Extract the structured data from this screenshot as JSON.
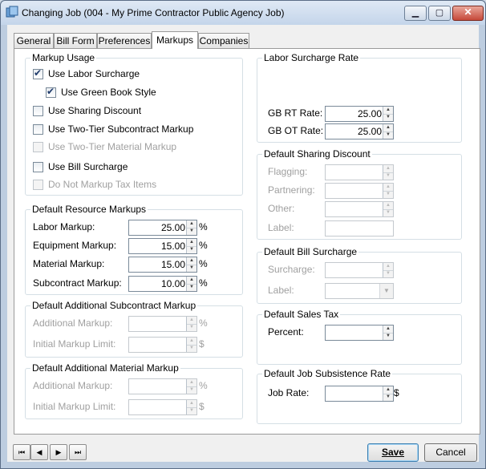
{
  "window": {
    "title": "Changing Job  (004 - My Prime Contractor Public Agency Job)",
    "minimize_glyph": "▁",
    "maximize_glyph": "▢",
    "close_glyph": "✕"
  },
  "tabs": [
    "General",
    "Bill Form",
    "Preferences",
    "Markups",
    "Companies"
  ],
  "active_tab": "Markups",
  "markup_usage": {
    "title": "Markup Usage",
    "use_labor_surcharge": {
      "label": "Use Labor Surcharge",
      "checked": true
    },
    "use_green_book_style": {
      "label": "Use Green Book Style",
      "checked": true
    },
    "use_sharing_discount": {
      "label": "Use Sharing Discount",
      "checked": false
    },
    "use_two_tier_subcontract": {
      "label": "Use Two-Tier Subcontract Markup",
      "checked": false
    },
    "use_two_tier_material": {
      "label": "Use Two-Tier Material Markup",
      "checked": false,
      "disabled": true
    },
    "use_bill_surcharge": {
      "label": "Use Bill Surcharge",
      "checked": false
    },
    "do_not_markup_tax": {
      "label": "Do Not Markup Tax Items",
      "checked": false,
      "disabled": true
    }
  },
  "resource_markups": {
    "title": "Default Resource Markups",
    "labor": {
      "label": "Labor Markup:",
      "value": "25.00",
      "unit": "%"
    },
    "equipment": {
      "label": "Equipment Markup:",
      "value": "15.00",
      "unit": "%"
    },
    "material": {
      "label": "Material Markup:",
      "value": "15.00",
      "unit": "%"
    },
    "subcontract": {
      "label": "Subcontract Markup:",
      "value": "10.00",
      "unit": "%"
    }
  },
  "additional_subcontract": {
    "title": "Default Additional Subcontract Markup",
    "additional": {
      "label": "Additional Markup:",
      "value": "",
      "unit": "%"
    },
    "initial_limit": {
      "label": "Initial Markup Limit:",
      "value": "",
      "unit": "$"
    }
  },
  "additional_material": {
    "title": "Default Additional Material Markup",
    "additional": {
      "label": "Additional Markup:",
      "value": "",
      "unit": "%"
    },
    "initial_limit": {
      "label": "Initial Markup Limit:",
      "value": "",
      "unit": "$"
    }
  },
  "labor_surcharge_rate": {
    "title": "Labor Surcharge Rate",
    "gb_rt": {
      "label": "GB RT Rate:",
      "value": "25.00"
    },
    "gb_ot": {
      "label": "GB OT Rate:",
      "value": "25.00"
    }
  },
  "sharing_discount": {
    "title": "Default Sharing Discount",
    "flagging": {
      "label": "Flagging:",
      "value": ""
    },
    "partnering": {
      "label": "Partnering:",
      "value": ""
    },
    "other": {
      "label": "Other:",
      "value": ""
    },
    "label": {
      "label": "Label:",
      "value": ""
    }
  },
  "bill_surcharge": {
    "title": "Default Bill Surcharge",
    "surcharge": {
      "label": "Surcharge:",
      "value": ""
    },
    "label": {
      "label": "Label:",
      "value": ""
    }
  },
  "sales_tax": {
    "title": "Default Sales Tax",
    "percent": {
      "label": "Percent:",
      "value": ""
    }
  },
  "subsistence_rate": {
    "title": "Default Job Subsistence Rate",
    "job_rate": {
      "label": "Job Rate:",
      "value": "",
      "unit": "$"
    }
  },
  "nav": {
    "first": "⏮",
    "prev": "◀",
    "next": "▶",
    "last": "⏭"
  },
  "buttons": {
    "save": "Save",
    "cancel": "Cancel"
  },
  "arrows": {
    "up": "▲",
    "down": "▼"
  }
}
